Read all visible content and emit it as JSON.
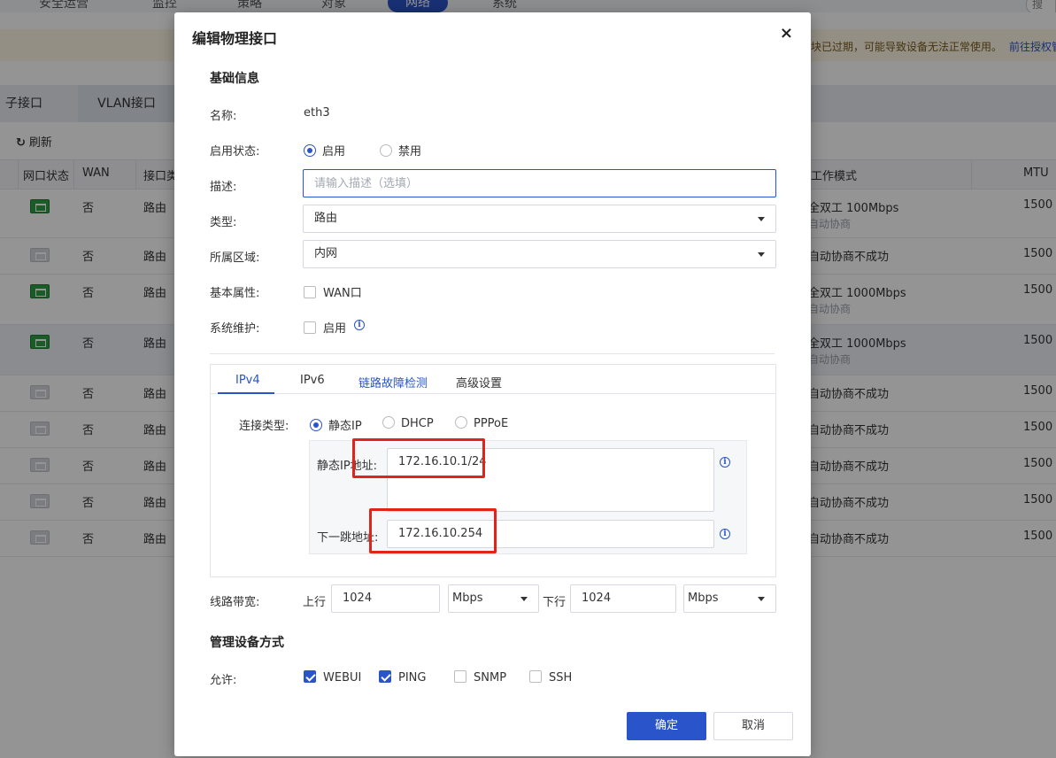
{
  "background": {
    "nav": [
      "安全运营",
      "监控",
      "策略",
      "对象",
      "网络",
      "系统"
    ],
    "search_hint": "搜",
    "warning": "块已过期，可能导致设备无法正常使用。",
    "warning_link": "前往授权管",
    "tabs": [
      "子接口",
      "VLAN接口"
    ],
    "refresh": "刷新",
    "columns": [
      "网口状态",
      "WAN",
      "接口类",
      "工作模式",
      "MTU"
    ],
    "rows": [
      {
        "status": "on",
        "wan": "否",
        "type": "路由",
        "mode": "全双工 100Mbps",
        "sub": "自动协商",
        "mtu": "1500"
      },
      {
        "status": "off",
        "wan": "否",
        "type": "路由",
        "mode": "自动协商不成功",
        "sub": "",
        "mtu": "1500"
      },
      {
        "status": "on",
        "wan": "否",
        "type": "路由",
        "mode": "全双工 1000Mbps",
        "sub": "自动协商",
        "mtu": "1500"
      },
      {
        "status": "on",
        "wan": "否",
        "type": "路由",
        "mode": "全双工 1000Mbps",
        "sub": "自动协商",
        "mtu": "1500"
      },
      {
        "status": "off",
        "wan": "否",
        "type": "路由",
        "mode": "自动协商不成功",
        "sub": "",
        "mtu": "1500"
      },
      {
        "status": "off",
        "wan": "否",
        "type": "路由",
        "mode": "自动协商不成功",
        "sub": "",
        "mtu": "1500"
      },
      {
        "status": "off",
        "wan": "否",
        "type": "路由",
        "mode": "自动协商不成功",
        "sub": "",
        "mtu": "1500"
      },
      {
        "status": "off",
        "wan": "否",
        "type": "路由",
        "mode": "自动协商不成功",
        "sub": "",
        "mtu": "1500"
      },
      {
        "status": "off",
        "wan": "否",
        "type": "路由",
        "mode": "自动协商不成功",
        "sub": "",
        "mtu": "1500"
      }
    ]
  },
  "modal": {
    "title": "编辑物理接口",
    "close": "×",
    "basic": {
      "title": "基础信息",
      "name_label": "名称:",
      "name_value": "eth3",
      "enable_label": "启用状态:",
      "enable_on": "启用",
      "enable_off": "禁用",
      "desc_label": "描述:",
      "desc_placeholder": "请输入描述（选填）",
      "type_label": "类型:",
      "type_value": "路由",
      "zone_label": "所属区域:",
      "zone_value": "内网",
      "attr_label": "基本属性:",
      "attr_wan": "WAN口",
      "maint_label": "系统维护:",
      "maint_enable": "启用"
    },
    "tabs": [
      "IPv4",
      "IPv6",
      "链路故障检测",
      "高级设置"
    ],
    "ipv4": {
      "conn_label": "连接类型:",
      "conn_options": [
        "静态IP",
        "DHCP",
        "PPPoE"
      ],
      "static_ip_label": "静态IP地址:",
      "static_ip_value": "172.16.10.1/24",
      "next_hop_label": "下一跳地址:",
      "next_hop_value": "172.16.10.254"
    },
    "bandwidth": {
      "label": "线路带宽:",
      "up_label": "上行",
      "up_value": "1024",
      "up_unit": "Mbps",
      "down_label": "下行",
      "down_value": "1024",
      "down_unit": "Mbps"
    },
    "mgmt": {
      "title": "管理设备方式",
      "allow_label": "允许:",
      "options": [
        {
          "label": "WEBUI",
          "checked": true
        },
        {
          "label": "PING",
          "checked": true
        },
        {
          "label": "SNMP",
          "checked": false
        },
        {
          "label": "SSH",
          "checked": false
        }
      ]
    },
    "buttons": {
      "ok": "确定",
      "cancel": "取消"
    }
  }
}
